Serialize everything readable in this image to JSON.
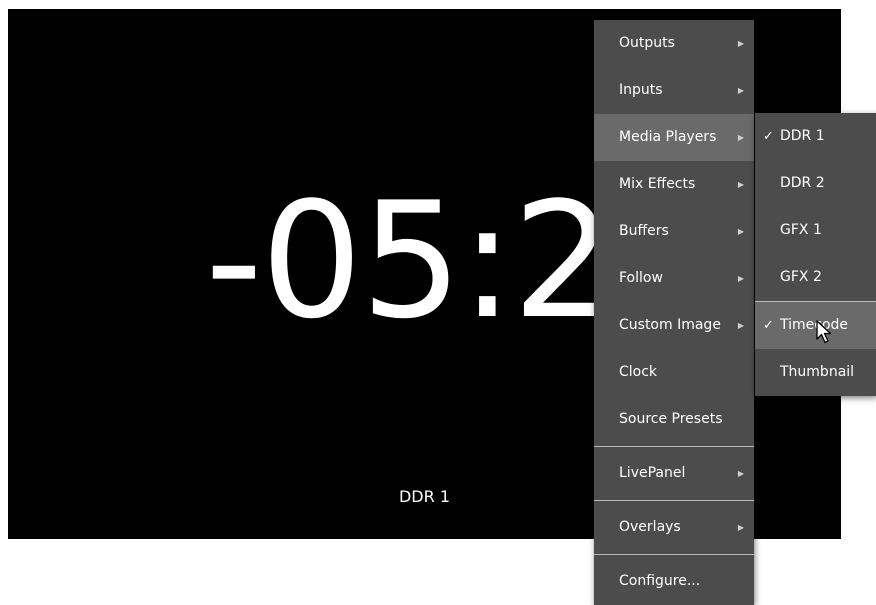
{
  "preview": {
    "timecode": "-05:2",
    "source_label": "DDR 1"
  },
  "menu": {
    "items": [
      {
        "label": "Outputs",
        "has_submenu": true
      },
      {
        "label": "Inputs",
        "has_submenu": true
      },
      {
        "label": "Media Players",
        "has_submenu": true,
        "active": true
      },
      {
        "label": "Mix Effects",
        "has_submenu": true
      },
      {
        "label": "Buffers",
        "has_submenu": true
      },
      {
        "label": "Follow",
        "has_submenu": true
      },
      {
        "label": "Custom Image",
        "has_submenu": true
      },
      {
        "label": "Clock",
        "has_submenu": false
      },
      {
        "label": "Source Presets",
        "has_submenu": false
      },
      {
        "label": "LivePanel",
        "has_submenu": true
      },
      {
        "label": "Overlays",
        "has_submenu": true
      },
      {
        "label": "Configure...",
        "has_submenu": false
      }
    ],
    "arrow_glyph": "▶"
  },
  "submenu": {
    "check_glyph": "✓",
    "items": [
      {
        "label": "DDR 1",
        "checked": true
      },
      {
        "label": "DDR 2",
        "checked": false
      },
      {
        "label": "GFX 1",
        "checked": false
      },
      {
        "label": "GFX 2",
        "checked": false
      },
      {
        "label": "Timecode",
        "checked": true,
        "hover": true
      },
      {
        "label": "Thumbnail",
        "checked": false
      }
    ]
  },
  "colors": {
    "menu_bg": "#4c4c4c",
    "menu_active": "#6a6a6a",
    "separator": "#b8b8b8",
    "preview_bg": "#000000",
    "text": "#ffffff"
  },
  "icons": {
    "cursor": "mouse-pointer-icon"
  }
}
